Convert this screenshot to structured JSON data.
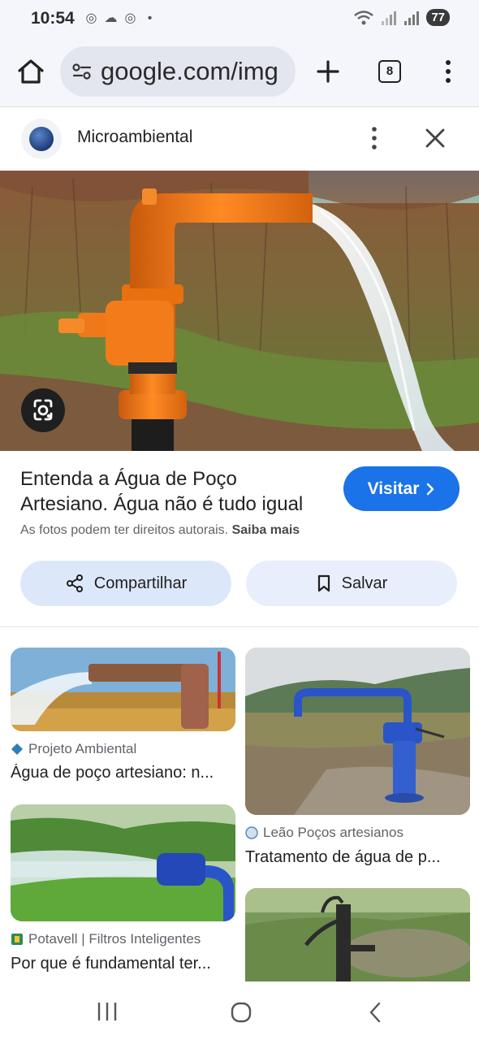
{
  "status": {
    "time": "10:54",
    "battery": "77"
  },
  "browser": {
    "url": "google.com/img",
    "tab_count": "8"
  },
  "source": {
    "name": "Microambiental"
  },
  "result": {
    "title": "Entenda a Água de Poço Artesiano. Água não é tudo igual",
    "visit_label": "Visitar",
    "copyright_text": "As fotos podem ter direitos autorais.",
    "learn_more": "Saiba mais",
    "share_label": "Compartilhar",
    "save_label": "Salvar"
  },
  "related": [
    {
      "source": "Projeto Ambiental",
      "title": "Água de poço artesiano: n..."
    },
    {
      "source": "Leão Poços artesianos",
      "title": "Tratamento de água de p..."
    },
    {
      "source": "Potavell | Filtros Inteligentes",
      "title": "Por que é fundamental ter..."
    },
    {
      "source": "",
      "title": ""
    }
  ],
  "colors": {
    "accent": "#1a73e8",
    "chip_bg": "#dde7fa",
    "pipe_orange": "#f07a1c",
    "pipe_blue": "#1f55c4"
  },
  "icons": [
    "home-icon",
    "site-info-icon",
    "plus-icon",
    "tabs-icon",
    "more-vert-icon",
    "close-icon",
    "lens-icon",
    "share-icon",
    "bookmark-icon",
    "chevron-right-icon",
    "recents-icon",
    "home-circle-icon",
    "back-icon"
  ]
}
